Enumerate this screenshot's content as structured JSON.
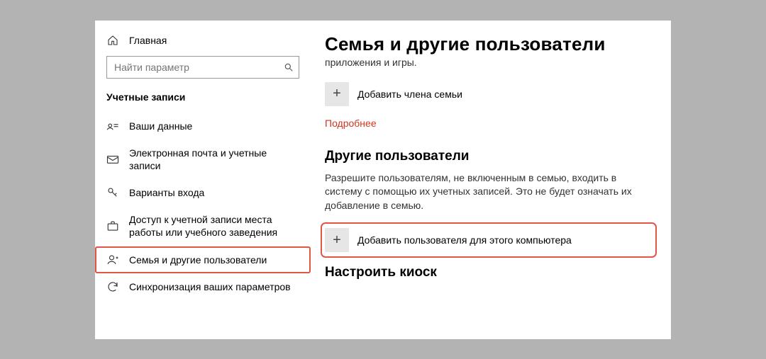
{
  "sidebar": {
    "home_label": "Главная",
    "search_placeholder": "Найти параметр",
    "category_label": "Учетные записи",
    "items": [
      {
        "label": "Ваши данные"
      },
      {
        "label": "Электронная почта и учетные записи"
      },
      {
        "label": "Варианты входа"
      },
      {
        "label": "Доступ к учетной записи места работы или учебного заведения"
      },
      {
        "label": "Семья и другие пользователи"
      },
      {
        "label": "Синхронизация ваших параметров"
      }
    ]
  },
  "content": {
    "title": "Семья и другие пользователи",
    "family_sub": "приложения и игры.",
    "add_family_member": "Добавить члена семьи",
    "learn_more": "Подробнее",
    "other_users_title": "Другие пользователи",
    "other_users_desc": "Разрешите пользователям, не включенным в семью, входить в систему с помощью их учетных записей. Это не будет означать их добавление в семью.",
    "add_other_user": "Добавить пользователя для этого компьютера",
    "kiosk_title": "Настроить киоск"
  }
}
